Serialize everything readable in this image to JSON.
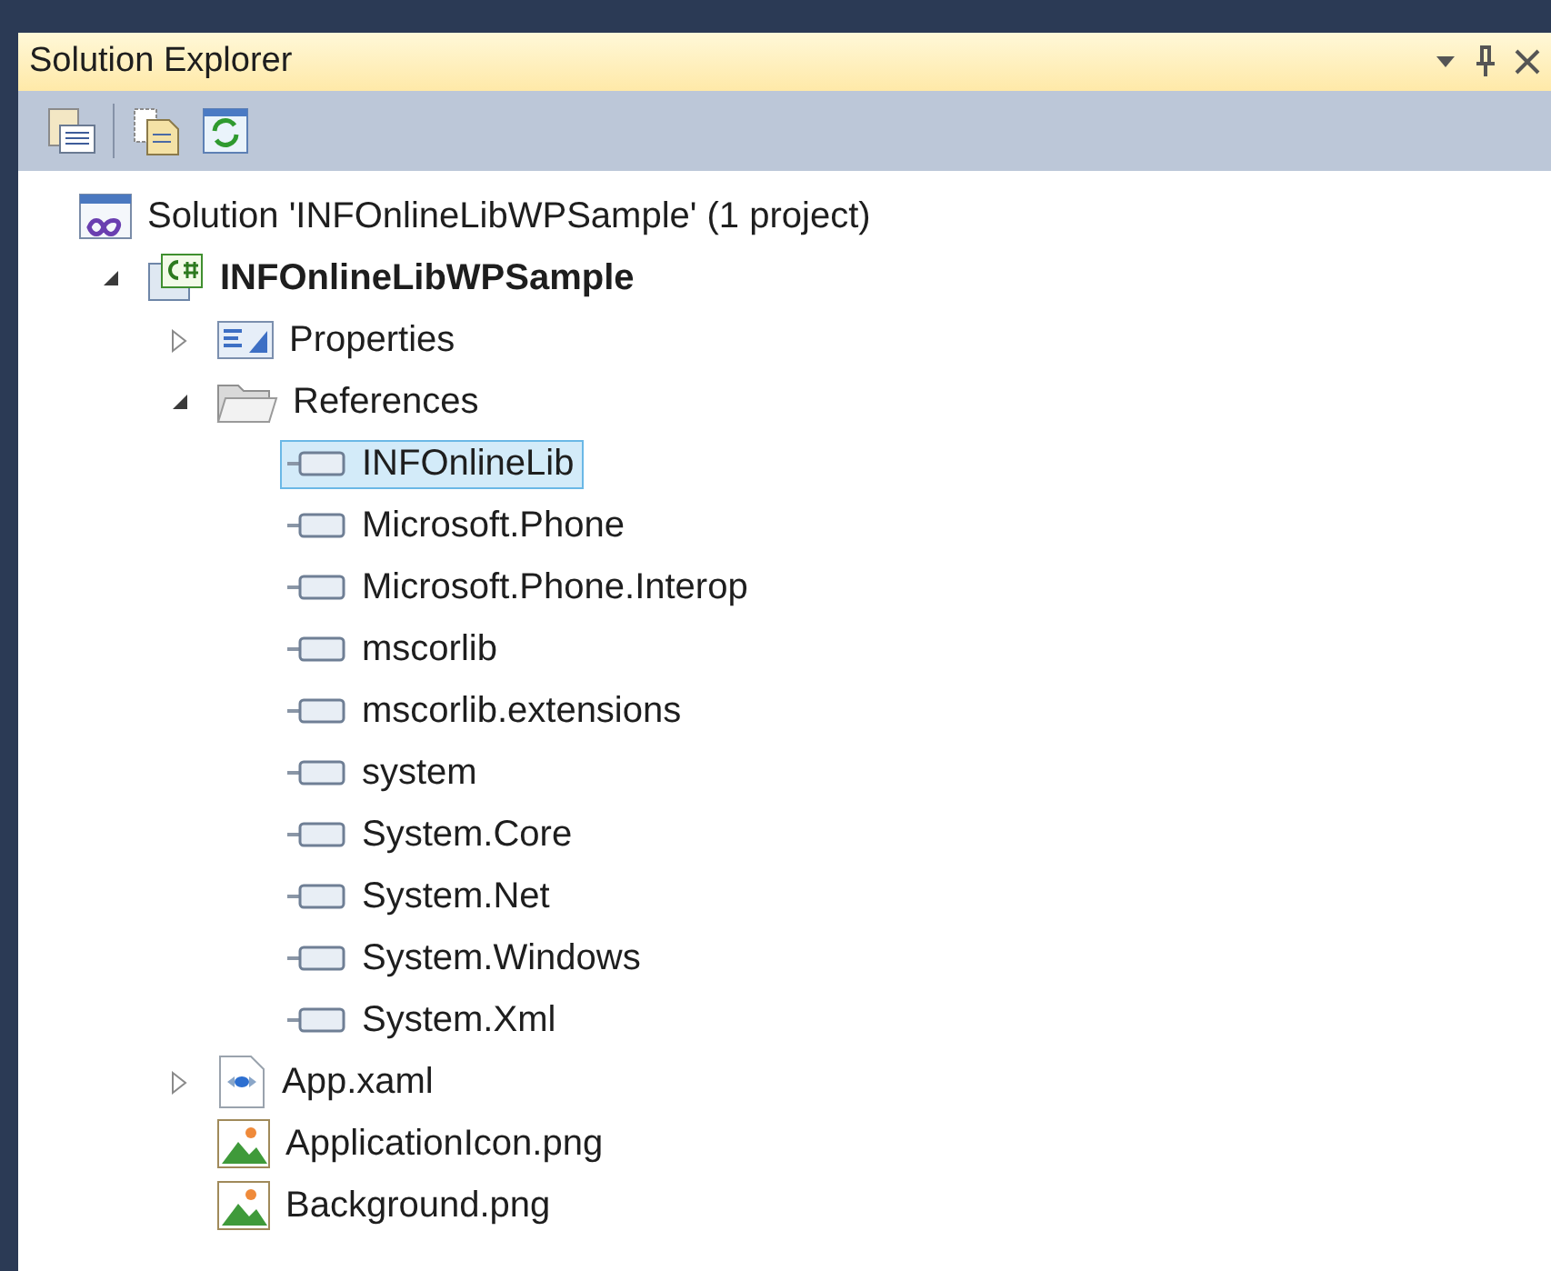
{
  "panel": {
    "title": "Solution Explorer"
  },
  "tree": [
    {
      "label": "Solution 'INFOnlineLibWPSample' (1 project)",
      "kind": "solution",
      "selected": false,
      "children": [
        {
          "label": "INFOnlineLibWPSample",
          "kind": "project",
          "expanded": true,
          "selected": false,
          "children": [
            {
              "label": "Properties",
              "kind": "properties",
              "expanded": false,
              "selected": false
            },
            {
              "label": "References",
              "kind": "folder",
              "expanded": true,
              "selected": false,
              "children": [
                {
                  "label": "INFOnlineLib",
                  "kind": "reference",
                  "selected": true
                },
                {
                  "label": "Microsoft.Phone",
                  "kind": "reference",
                  "selected": false
                },
                {
                  "label": "Microsoft.Phone.Interop",
                  "kind": "reference",
                  "selected": false
                },
                {
                  "label": "mscorlib",
                  "kind": "reference",
                  "selected": false
                },
                {
                  "label": "mscorlib.extensions",
                  "kind": "reference",
                  "selected": false
                },
                {
                  "label": "system",
                  "kind": "reference",
                  "selected": false
                },
                {
                  "label": "System.Core",
                  "kind": "reference",
                  "selected": false
                },
                {
                  "label": "System.Net",
                  "kind": "reference",
                  "selected": false
                },
                {
                  "label": "System.Windows",
                  "kind": "reference",
                  "selected": false
                },
                {
                  "label": "System.Xml",
                  "kind": "reference",
                  "selected": false
                }
              ]
            },
            {
              "label": "App.xaml",
              "kind": "xaml",
              "expanded": false,
              "selected": false
            },
            {
              "label": "ApplicationIcon.png",
              "kind": "image",
              "selected": false
            },
            {
              "label": "Background.png",
              "kind": "image",
              "selected": false
            }
          ]
        }
      ]
    }
  ]
}
